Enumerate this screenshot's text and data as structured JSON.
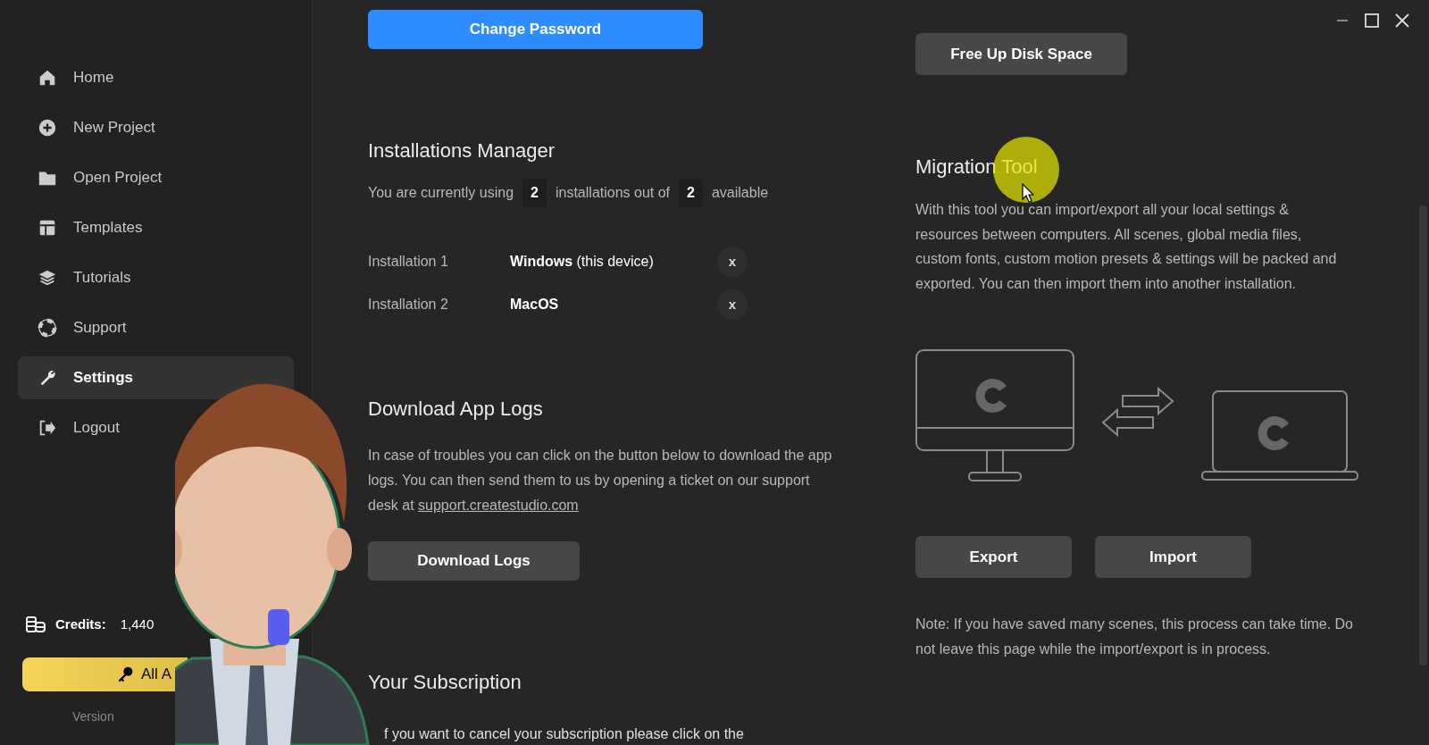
{
  "sidebar": {
    "items": [
      {
        "label": "Home",
        "selected": false
      },
      {
        "label": "New Project",
        "selected": false
      },
      {
        "label": "Open Project",
        "selected": false
      },
      {
        "label": "Templates",
        "selected": false
      },
      {
        "label": "Tutorials",
        "selected": false
      },
      {
        "label": "Support",
        "selected": false
      },
      {
        "label": "Settings",
        "selected": true
      },
      {
        "label": "Logout",
        "selected": false
      }
    ],
    "credits": {
      "label": "Credits:",
      "value": "1,440"
    },
    "access_button": "All A",
    "version": "Version"
  },
  "account": {
    "change_password_button": "Change Password"
  },
  "installations": {
    "title": "Installations Manager",
    "using_prefix": "You are currently using",
    "used": "2",
    "middle": "installations out of",
    "total": "2",
    "suffix": "available",
    "rows": [
      {
        "label": "Installation 1",
        "device": "**Windows** (this device)",
        "remove": "x"
      },
      {
        "label": "Installation 2",
        "device": "**MacOS**",
        "remove": "x"
      }
    ]
  },
  "logs": {
    "title": "Download App Logs",
    "text": "In case of troubles you can click on the button below to download the app logs. You can then send them to us by opening a ticket on our support desk at",
    "link": "support.createstudio.com",
    "button": "Download Logs"
  },
  "subscription": {
    "title": "Your Subscription",
    "text": "f you want to cancel your subscription please click on the"
  },
  "disk": {
    "button": "Free Up Disk Space"
  },
  "migration": {
    "title": "Migration Tool",
    "text": "With this tool you can import/export all your local settings & resources between computers. All scenes, global media files, custom fonts, custom motion presets & settings will be packed and exported. You can then import them into another installation.",
    "export_button": "Export",
    "import_button": "Import",
    "note": "Note: If you have saved many scenes, this process can take time. Do not leave this page while the import/export is in process."
  }
}
